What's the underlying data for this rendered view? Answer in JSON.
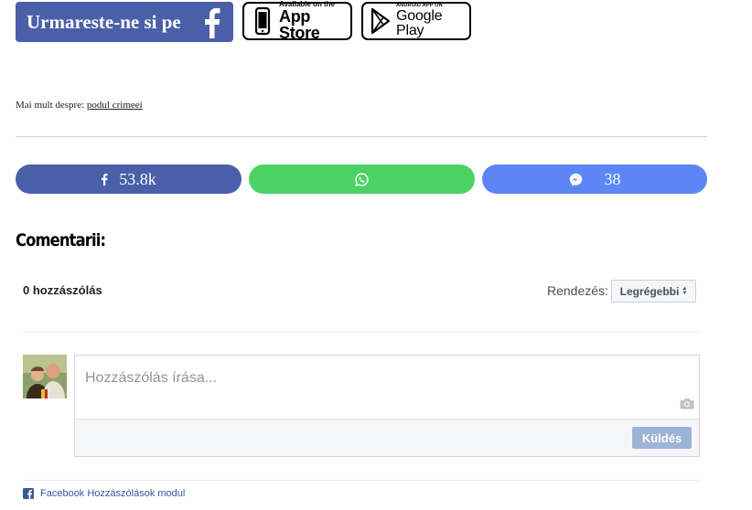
{
  "banners": {
    "follow_text": "Urmareste-ne si pe",
    "follow_icon": "facebook-f-icon",
    "appstore_small": "Available on the",
    "appstore_big": "App Store",
    "googleplay_small": "ANDROID APP ON",
    "googleplay_big": "Google Play"
  },
  "article": {
    "more_about_label": "Mai mult despre:",
    "more_about_link": "podul crimeei"
  },
  "share": {
    "facebook_count": "53.8k",
    "messenger_count": "38",
    "colors": {
      "facebook": "#4a5fa8",
      "whatsapp": "#4cd264",
      "messenger": "#5c86f5"
    }
  },
  "comments": {
    "heading": "Comentarii:",
    "count_label": "0 hozzászólás",
    "sort_label": "Rendezés:",
    "sort_selected": "Legrégebbi",
    "input_placeholder": "Hozzászólás írása...",
    "send_label": "Küldés",
    "plugin_credit": "Facebook Hozzászólások modul"
  }
}
